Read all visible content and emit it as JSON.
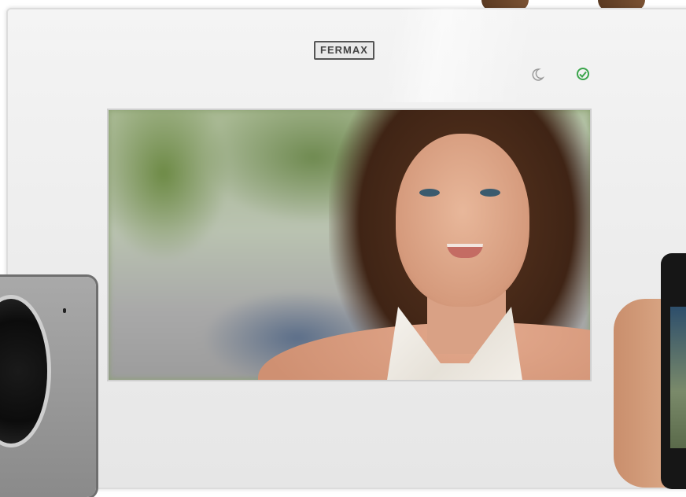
{
  "brand": {
    "logo_text": "FERMAX"
  },
  "panel": {
    "color": "#eeeeee",
    "icons": [
      "moon-icon",
      "check-circle-icon"
    ],
    "accent": "#3aa54b"
  },
  "screen": {
    "subject": "video-feed"
  }
}
